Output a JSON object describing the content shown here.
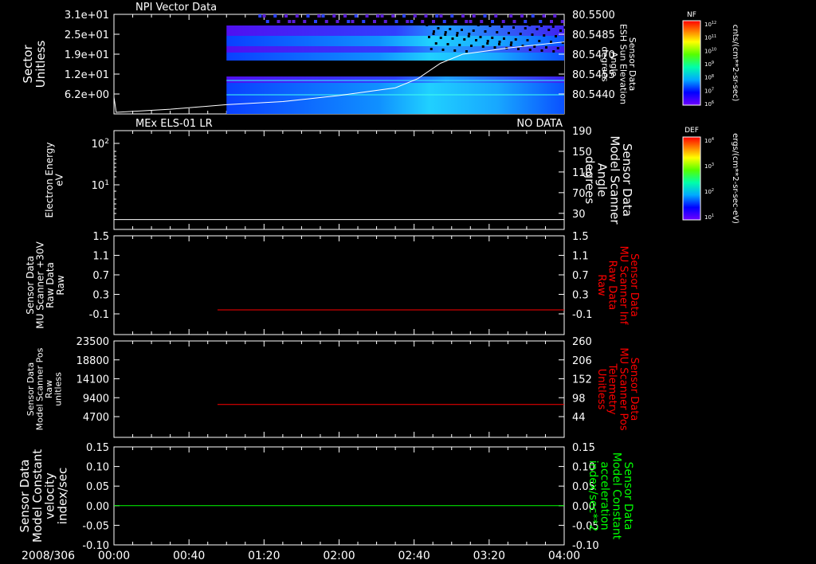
{
  "chart_data": [
    {
      "type": "heatmap",
      "title": "NPI Vector Data",
      "ylabel": [
        "Sector",
        "Unitless"
      ],
      "yticks": [
        "3.1e+01",
        "2.5e+01",
        "1.9e+01",
        "1.2e+01",
        "6.2e+00"
      ],
      "y2label": [
        "Sensor Data",
        "ESH Sun Elevation",
        "Angle",
        "degrees"
      ],
      "y2ticks": [
        "80.5500",
        "80.5485",
        "80.5470",
        "80.5455",
        "80.5440"
      ],
      "colorbar": {
        "label": "NF",
        "units": "cnts/(cm**2-sr-sec)",
        "ticks": [
          "10^12",
          "10^11",
          "10^10",
          "10^9",
          "10^8",
          "10^7",
          "10^6"
        ]
      },
      "data_start_hours": 1.0,
      "line": {
        "color": "#ffffff",
        "x_hours": [
          0.0,
          0.02,
          0.5,
          1.0,
          1.5,
          2.0,
          2.5,
          2.7,
          2.9,
          3.1,
          3.5,
          4.0
        ],
        "y_deg": [
          80.5446,
          80.5436,
          80.5438,
          80.5441,
          80.5443,
          80.5447,
          80.5452,
          80.5458,
          80.5468,
          80.5474,
          80.5478,
          80.5482
        ]
      }
    },
    {
      "type": "line",
      "title": "MEx ELS-01 LR",
      "status": "NO DATA",
      "ylabel": [
        "Electron Energy",
        "eV"
      ],
      "yticks": [
        "10^2",
        "10^1"
      ],
      "y2label": [
        "Sensor Data",
        "Model Scanner",
        "Angle",
        "degrees"
      ],
      "y2ticks": [
        "190",
        "150",
        "110",
        "70",
        "30"
      ],
      "y2lim": [
        5,
        190
      ],
      "colorbar": {
        "label": "DEF",
        "units": "ergs/(cm**2-sr-sec-eV)",
        "ticks": [
          "10^4",
          "10^3",
          "10^2",
          "10^1"
        ]
      },
      "series": [
        {
          "color": "#ffffff",
          "x_hours": [
            0.0,
            4.0
          ],
          "y": [
            18,
            18
          ]
        }
      ]
    },
    {
      "type": "line",
      "ylabel": [
        "Sensor Data",
        "MU Scanner +30V",
        "Raw Data",
        "Raw"
      ],
      "yticks": [
        "1.5",
        "1.1",
        "0.7",
        "0.3",
        "-0.1"
      ],
      "y2label": [
        "Sensor Data",
        "MU Scanner Inf",
        "Raw Data",
        "Raw"
      ],
      "y2ticks": [
        "1.5",
        "1.1",
        "0.7",
        "0.3",
        "-0.1"
      ],
      "ylim": [
        -0.3,
        1.5
      ],
      "series": [
        {
          "color": "#ff0000",
          "x_hours": [
            0.92,
            4.0
          ],
          "y": [
            0.15,
            0.15
          ]
        }
      ]
    },
    {
      "type": "line",
      "ylabel": [
        "Sensor Data",
        "Model Scanner Pos",
        "Raw",
        "unitless"
      ],
      "yticks": [
        "23500",
        "18800",
        "14100",
        "9400",
        "4700"
      ],
      "y2label": [
        "Sensor Data",
        "MU Scanner Pos",
        "Telemetry",
        "Unitless"
      ],
      "y2ticks": [
        "260",
        "206",
        "152",
        "98",
        "44"
      ],
      "ylim": [
        0,
        23500
      ],
      "series": [
        {
          "color": "#ff0000",
          "x_hours": [
            0.92,
            4.0
          ],
          "y": [
            8000,
            8000
          ]
        }
      ]
    },
    {
      "type": "line",
      "ylabel": [
        "Sensor Data",
        "Model Constant",
        "velocity",
        "index/sec"
      ],
      "yticks": [
        "0.15",
        "0.10",
        "0.05",
        "0.00",
        "-0.05",
        "-0.10"
      ],
      "y2label": [
        "Sensor Data",
        "Model Constant",
        "acceleration",
        "index/sec**2"
      ],
      "y2ticks": [
        "0.15",
        "0.10",
        "0.05",
        "0.00",
        "-0.05",
        "-0.10"
      ],
      "ylim": [
        -0.1,
        0.15
      ],
      "series": [
        {
          "color": "#00ff00",
          "x_hours": [
            0.0,
            4.0
          ],
          "y": [
            0.0,
            0.0
          ]
        }
      ]
    }
  ],
  "time_axis": {
    "date": "2008/306",
    "labels": [
      "00:00",
      "00:40",
      "01:20",
      "02:00",
      "02:40",
      "03:20",
      "04:00"
    ],
    "label_hours": [
      0,
      0.6667,
      1.3333,
      2.0,
      2.6667,
      3.3333,
      4.0
    ],
    "range_hours": [
      0,
      4
    ]
  },
  "colors": {
    "line2": "#ff0000",
    "line5": "#00ff00",
    "axis": "#ffffff"
  }
}
